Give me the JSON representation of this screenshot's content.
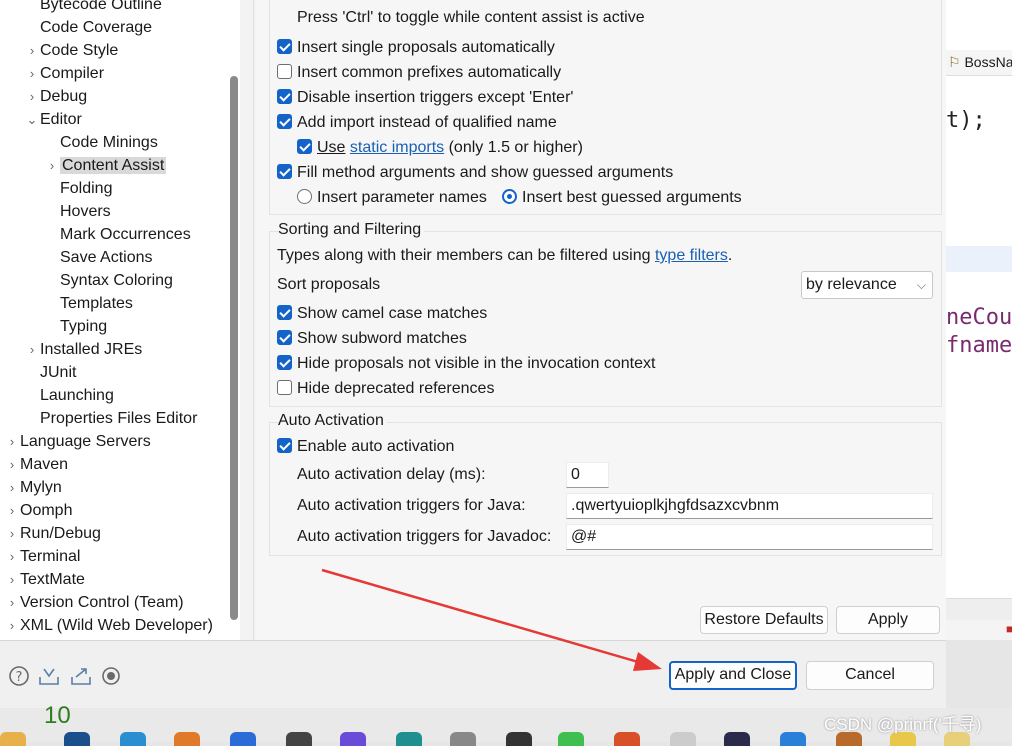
{
  "background_editor": {
    "tab_label": "BossNa",
    "code_line1": "t);",
    "code_line2": "neCour",
    "code_line3": "fname"
  },
  "tree": {
    "items": [
      {
        "label": "Bytecode Outline",
        "chev": ""
      },
      {
        "label": "Code Coverage",
        "chev": ""
      },
      {
        "label": "Code Style",
        "chev": "›"
      },
      {
        "label": "Compiler",
        "chev": "›"
      },
      {
        "label": "Debug",
        "chev": "›"
      },
      {
        "label": "Editor",
        "chev": "⌄"
      },
      {
        "label": "Code Minings",
        "chev": ""
      },
      {
        "label": "Content Assist",
        "chev": "›"
      },
      {
        "label": "Folding",
        "chev": ""
      },
      {
        "label": "Hovers",
        "chev": ""
      },
      {
        "label": "Mark Occurrences",
        "chev": ""
      },
      {
        "label": "Save Actions",
        "chev": ""
      },
      {
        "label": "Syntax Coloring",
        "chev": ""
      },
      {
        "label": "Templates",
        "chev": ""
      },
      {
        "label": "Typing",
        "chev": ""
      },
      {
        "label": "Installed JREs",
        "chev": "›"
      },
      {
        "label": "JUnit",
        "chev": ""
      },
      {
        "label": "Launching",
        "chev": ""
      },
      {
        "label": "Properties Files Editor",
        "chev": ""
      },
      {
        "label": "Language Servers",
        "chev": "›"
      },
      {
        "label": "Maven",
        "chev": "›"
      },
      {
        "label": "Mylyn",
        "chev": "›"
      },
      {
        "label": "Oomph",
        "chev": "›"
      },
      {
        "label": "Run/Debug",
        "chev": "›"
      },
      {
        "label": "Terminal",
        "chev": "›"
      },
      {
        "label": "TextMate",
        "chev": "›"
      },
      {
        "label": "Version Control (Team)",
        "chev": "›"
      },
      {
        "label": "XML (Wild Web Developer)",
        "chev": "›"
      }
    ]
  },
  "insertion": {
    "hint": "Press 'Ctrl' to toggle while content assist is active",
    "opt_single": "Insert single proposals automatically",
    "opt_prefixes": "Insert common prefixes automatically",
    "opt_disable_triggers": "Disable insertion triggers except 'Enter'",
    "opt_add_import": "Add import instead of qualified name",
    "opt_use": "Use",
    "opt_static_link": "static imports",
    "opt_static_suffix": " (only 1.5 or higher)",
    "opt_fill_args": "Fill method arguments and show guessed arguments",
    "radio_param_names": "Insert parameter names",
    "radio_best_guessed": "Insert best guessed arguments"
  },
  "sorting": {
    "title": "Sorting and Filtering",
    "desc_prefix": "Types along with their members can be filtered using ",
    "desc_link": "type filters",
    "desc_suffix": ".",
    "sort_label": "Sort proposals",
    "sort_value": "by relevance",
    "opt_camel": "Show camel case matches",
    "opt_subword": "Show subword matches",
    "opt_hide_invisible": "Hide proposals not visible in the invocation context",
    "opt_hide_deprecated": "Hide deprecated references"
  },
  "auto_activation": {
    "title": "Auto Activation",
    "opt_enable": "Enable auto activation",
    "delay_label": "Auto activation delay (ms):",
    "delay_value": "0",
    "java_label": "Auto activation triggers for Java:",
    "java_value": ".qwertyuioplkjhgfdsazxcvbnm",
    "javadoc_label": "Auto activation triggers for Javadoc:",
    "javadoc_value": "@#"
  },
  "buttons": {
    "restore_defaults": "Restore Defaults",
    "apply": "Apply",
    "apply_and_close": "Apply and Close",
    "cancel": "Cancel"
  },
  "bottom_icons": [
    "help-icon",
    "import-icon",
    "export-icon",
    "record-icon"
  ],
  "taskbar": {
    "number": "10"
  },
  "watermark": "CSDN @prinrf('千寻)",
  "colors": {
    "accent": "#1463c8",
    "link": "#1a5fb4",
    "arrow": "#e53935"
  }
}
